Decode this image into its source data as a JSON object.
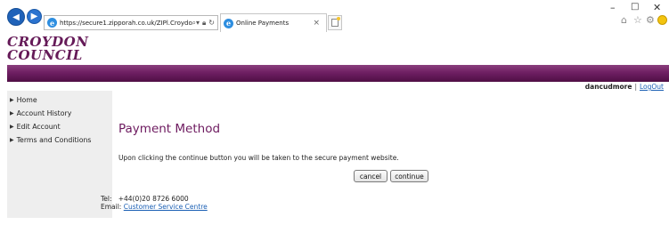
{
  "browser": {
    "url": "https://secure1.zipporah.co.uk/ZIPl.Croydon/",
    "tab_title": "Online Payments",
    "tab_close": "×",
    "window_min": "–",
    "window_max": "□",
    "window_close": "✕"
  },
  "site": {
    "logo_line1": "CROYDON",
    "logo_line2": "COUNCIL"
  },
  "user_bar": {
    "username": "dancudmore",
    "separator": "|",
    "logout": "LogOut"
  },
  "sidebar": {
    "items": [
      {
        "label": "Home"
      },
      {
        "label": "Account History"
      },
      {
        "label": "Edit Account"
      },
      {
        "label": "Terms and Conditions"
      }
    ]
  },
  "main": {
    "title": "Payment Method",
    "notice": "Upon clicking the continue button you will be taken to the secure payment website.",
    "cancel_label": "cancel",
    "continue_label": "continue"
  },
  "contact": {
    "tel_label": "Tel:",
    "tel_value": "+44(0)20 8726 6000",
    "email_label": "Email:",
    "email_value": "Customer Service Centre"
  },
  "colors": {
    "brand_purple": "#6d1a5f",
    "link_blue": "#1a5fb4",
    "sidebar_bg": "#eeeeee"
  }
}
